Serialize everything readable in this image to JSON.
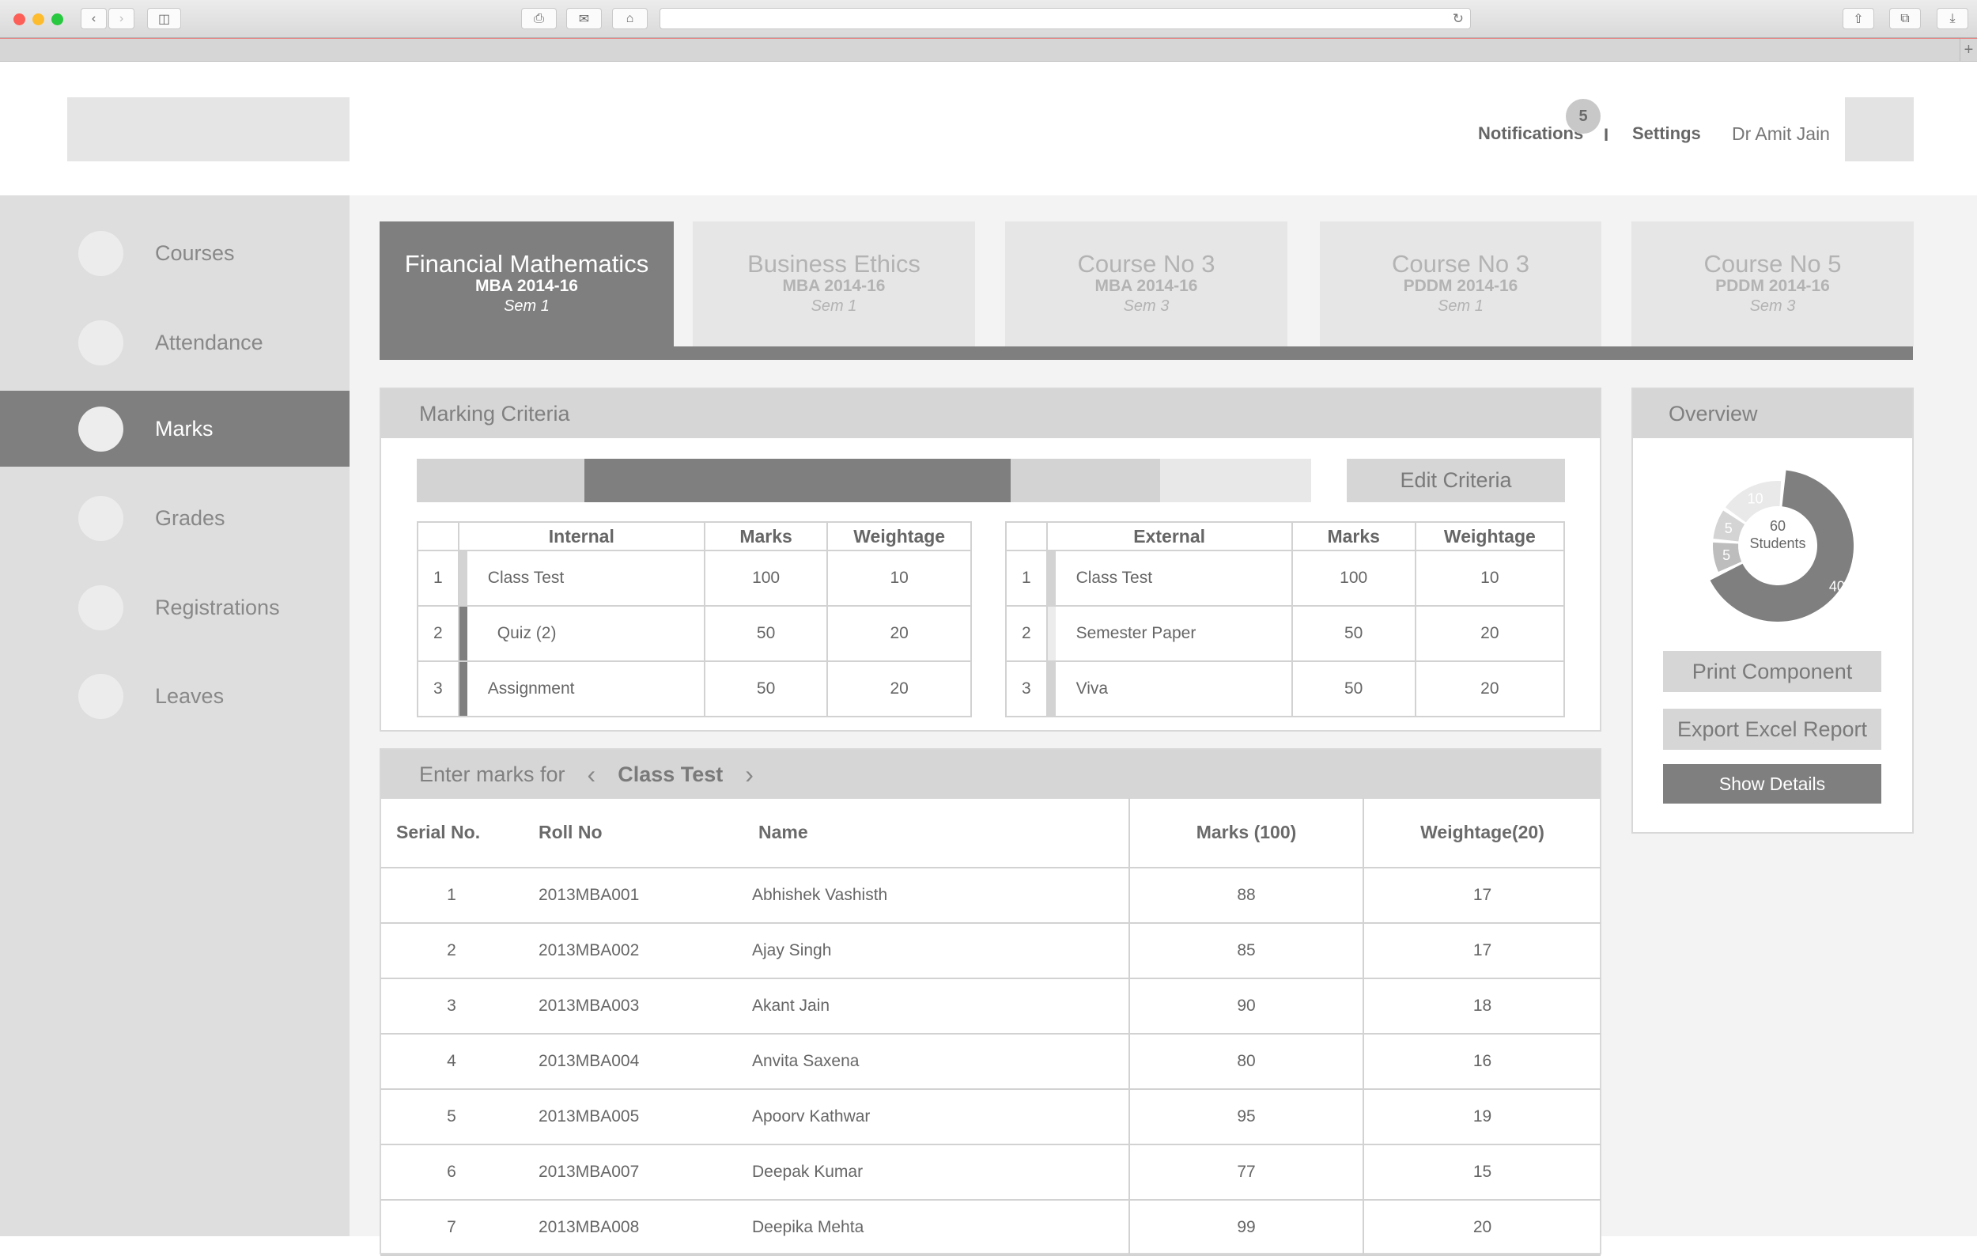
{
  "header": {
    "notifications_label": "Notifications",
    "notifications_count": "5",
    "separator": "I",
    "settings_label": "Settings",
    "user_name": "Dr Amit Jain"
  },
  "sidebar": {
    "items": [
      {
        "label": "Courses"
      },
      {
        "label": "Attendance"
      },
      {
        "label": "Marks"
      },
      {
        "label": "Grades"
      },
      {
        "label": "Registrations"
      },
      {
        "label": "Leaves"
      }
    ]
  },
  "course_tabs": [
    {
      "title": "Financial Mathematics",
      "program": "MBA 2014-16",
      "sem": "Sem 1"
    },
    {
      "title": "Business Ethics",
      "program": "MBA 2014-16",
      "sem": "Sem 1"
    },
    {
      "title": "Course No 3",
      "program": "MBA 2014-16",
      "sem": "Sem 3"
    },
    {
      "title": "Course No 3",
      "program": "PDDM 2014-16",
      "sem": "Sem 1"
    },
    {
      "title": "Course No 5",
      "program": "PDDM 2014-16",
      "sem": "Sem 3"
    }
  ],
  "marking_criteria": {
    "title": "Marking Criteria",
    "edit_button": "Edit Criteria",
    "internal": {
      "headers": [
        "Internal",
        "Marks",
        "Weightage"
      ],
      "rows": [
        {
          "n": "1",
          "name": "Class Test",
          "marks": "100",
          "weight": "10"
        },
        {
          "n": "2",
          "name": "Quiz (2)",
          "marks": "50",
          "weight": "20"
        },
        {
          "n": "3",
          "name": "Assignment",
          "marks": "50",
          "weight": "20"
        }
      ]
    },
    "external": {
      "headers": [
        "External",
        "Marks",
        "Weightage"
      ],
      "rows": [
        {
          "n": "1",
          "name": "Class Test",
          "marks": "100",
          "weight": "10"
        },
        {
          "n": "2",
          "name": "Semester Paper",
          "marks": "50",
          "weight": "20"
        },
        {
          "n": "3",
          "name": "Viva",
          "marks": "50",
          "weight": "20"
        }
      ]
    }
  },
  "enter_marks": {
    "prefix": "Enter marks for",
    "current": "Class Test",
    "headers": [
      "Serial No.",
      "Roll No",
      "Name",
      "Marks (100)",
      "Weightage(20)"
    ],
    "rows": [
      {
        "serial": "1",
        "roll": "2013MBA001",
        "name": "Abhishek Vashisth",
        "marks": "88",
        "weight": "17"
      },
      {
        "serial": "2",
        "roll": "2013MBA002",
        "name": "Ajay Singh",
        "marks": "85",
        "weight": "17"
      },
      {
        "serial": "3",
        "roll": "2013MBA003",
        "name": "Akant Jain",
        "marks": "90",
        "weight": "18"
      },
      {
        "serial": "4",
        "roll": "2013MBA004",
        "name": "Anvita Saxena",
        "marks": "80",
        "weight": "16"
      },
      {
        "serial": "5",
        "roll": "2013MBA005",
        "name": "Apoorv Kathwar",
        "marks": "95",
        "weight": "19"
      },
      {
        "serial": "6",
        "roll": "2013MBA007",
        "name": "Deepak Kumar",
        "marks": "77",
        "weight": "15"
      },
      {
        "serial": "7",
        "roll": "2013MBA008",
        "name": "Deepika Mehta",
        "marks": "99",
        "weight": "20"
      }
    ]
  },
  "overview": {
    "title": "Overview",
    "center_count": "60",
    "center_label": "Students",
    "segments": [
      {
        "value": 40,
        "label": "40",
        "color": "#7f7f7f"
      },
      {
        "value": 5,
        "label": "5",
        "color": "#bdbdbd"
      },
      {
        "value": 5,
        "label": "5",
        "color": "#d4d4d4"
      },
      {
        "value": 10,
        "label": "10",
        "color": "#e9e9e9"
      }
    ],
    "buttons": {
      "print": "Print Component",
      "export": "Export Excel Report",
      "details": "Show Details"
    }
  }
}
